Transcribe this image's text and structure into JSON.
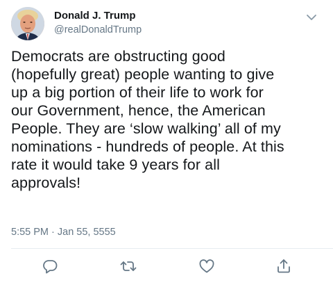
{
  "tweet": {
    "display_name": "Donald J. Trump",
    "handle": "@realDonaldTrump",
    "text": "Democrats are obstructing good\n(hopefully great) people wanting to give\nup a big portion of their life to work for\nour Government, hence, the American\nPeople. They are ‘slow walking’ all of my\nnominations - hundreds of people. At this\nrate it would take 9 years for all\napprovals!",
    "timestamp": "5:55 PM · Jan 55, 5555"
  },
  "icons": {
    "menu": "chevron-down-icon",
    "reply": "reply-icon",
    "retweet": "retweet-icon",
    "like": "heart-icon",
    "share": "share-icon"
  },
  "colors": {
    "icon_gray": "#657786",
    "divider": "#e6ecf0",
    "text": "#14171a"
  }
}
